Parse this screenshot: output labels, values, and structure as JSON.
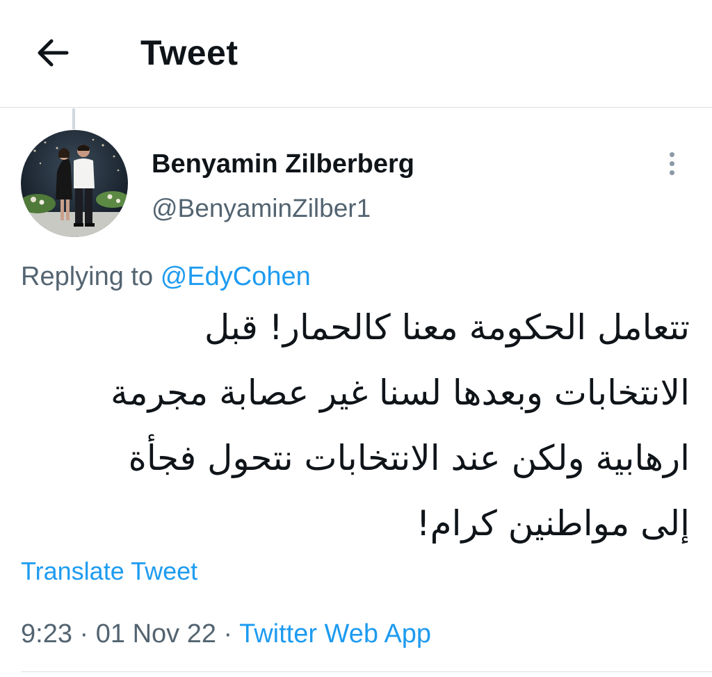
{
  "header": {
    "title": "Tweet",
    "back_icon": "arrow-left-icon"
  },
  "tweet": {
    "author": {
      "display_name": "Benyamin Zilberberg",
      "handle": "@BenyaminZilber1",
      "avatar_icon": "profile-photo"
    },
    "more_icon": "vertical-ellipsis-icon",
    "replying_prefix": "Replying to",
    "replying_to": "@EdyCohen",
    "text_lines": [
      "تتعامل الحكومة معنا كالحمار! قبل",
      "الانتخابات وبعدها لسنا غير عصابة مجرمة",
      "ارهابية ولكن عند الانتخابات نتحول فجأة",
      "إلى مواطنين كرام!"
    ],
    "translate_label": "Translate Tweet",
    "time": "9:23",
    "date": "01 Nov 22",
    "separator": "·",
    "source": "Twitter Web App"
  },
  "colors": {
    "text": "#0f1419",
    "secondary": "#536471",
    "accent": "#1d9bf0",
    "divider": "#dcdfe2"
  }
}
